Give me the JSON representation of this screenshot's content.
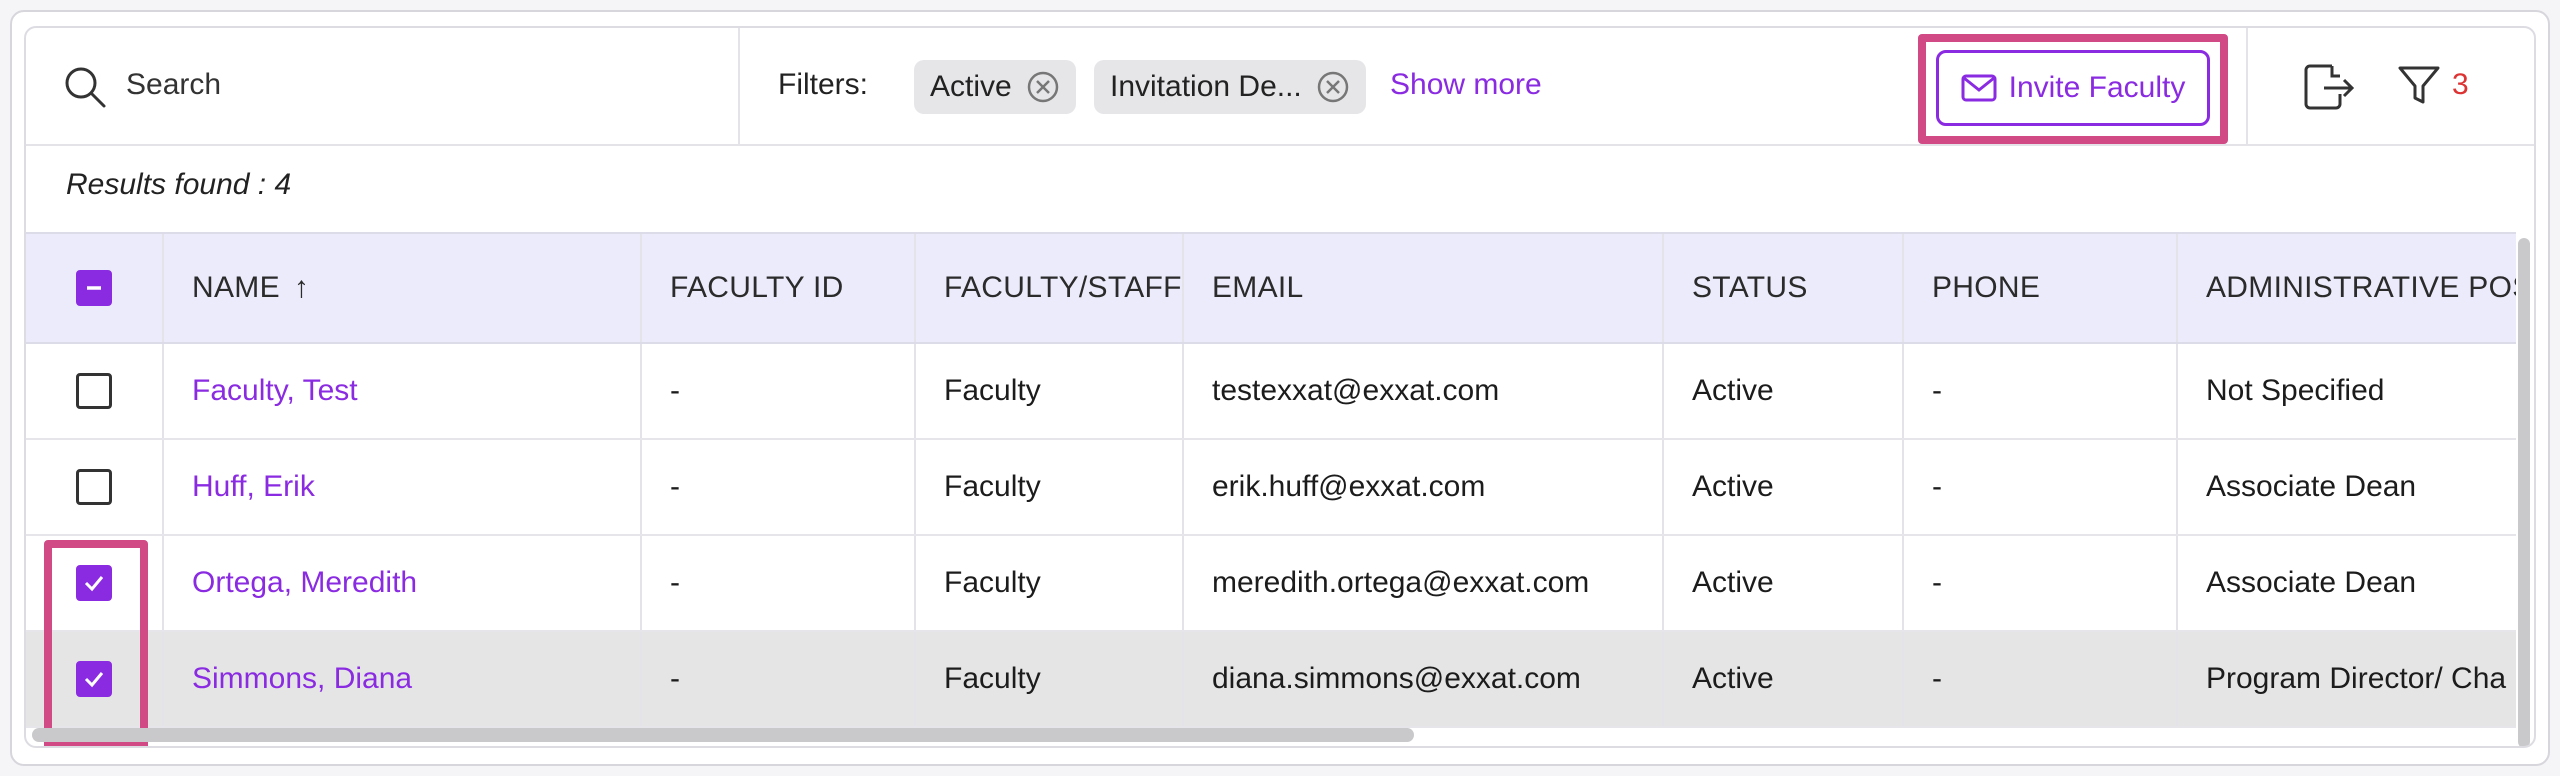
{
  "toolbar": {
    "search_placeholder": "Search",
    "filters_label": "Filters:",
    "filter_chips": [
      {
        "label": "Active"
      },
      {
        "label": "Invitation De..."
      }
    ],
    "show_more": "Show more",
    "invite_button": "Invite Faculty",
    "filter_count": "3"
  },
  "results_text": "Results found : 4",
  "table": {
    "columns": [
      "NAME",
      "FACULTY ID",
      "FACULTY/STAFF",
      "EMAIL",
      "STATUS",
      "PHONE",
      "ADMINISTRATIVE POSI"
    ],
    "sort_indicator": "↑",
    "rows": [
      {
        "name": "Faculty, Test",
        "faculty_id": "-",
        "type": "Faculty",
        "email": "testexxat@exxat.com",
        "status": "Active",
        "phone": "-",
        "position": "Not Specified",
        "checked": false
      },
      {
        "name": "Huff, Erik",
        "faculty_id": "-",
        "type": "Faculty",
        "email": "erik.huff@exxat.com",
        "status": "Active",
        "phone": "-",
        "position": "Associate Dean",
        "checked": false
      },
      {
        "name": "Ortega, Meredith",
        "faculty_id": "-",
        "type": "Faculty",
        "email": "meredith.ortega@exxat.com",
        "status": "Active",
        "phone": "-",
        "position": "Associate Dean",
        "checked": true
      },
      {
        "name": "Simmons, Diana",
        "faculty_id": "-",
        "type": "Faculty",
        "email": "diana.simmons@exxat.com",
        "status": "Active",
        "phone": "-",
        "position": "Program Director/ Cha",
        "checked": true
      }
    ]
  },
  "colors": {
    "accent": "#8a2be2",
    "highlight": "#d14a86",
    "header_bg": "#ebebfb",
    "count_red": "#dd3333"
  }
}
